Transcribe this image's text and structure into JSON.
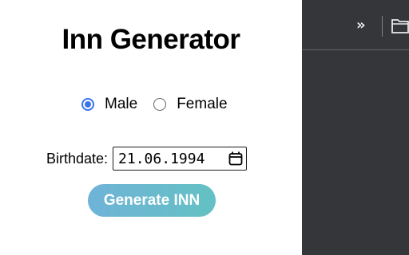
{
  "popup": {
    "title": "Inn Generator",
    "gender": {
      "options": [
        {
          "label": "Male",
          "checked": true
        },
        {
          "label": "Female",
          "checked": false
        }
      ]
    },
    "birthdate": {
      "label": "Birthdate:",
      "value": "21.06.1994"
    },
    "generate_label": "Generate INN"
  },
  "browser": {
    "chevron": "»",
    "icons": [
      "chevron-double-right-icon",
      "folder-icon"
    ]
  },
  "colors": {
    "radio_accent": "#3b74e8",
    "button_gradient_start": "#6fb3d8",
    "button_gradient_end": "#64c1c3",
    "browser_bg": "#35363a"
  }
}
